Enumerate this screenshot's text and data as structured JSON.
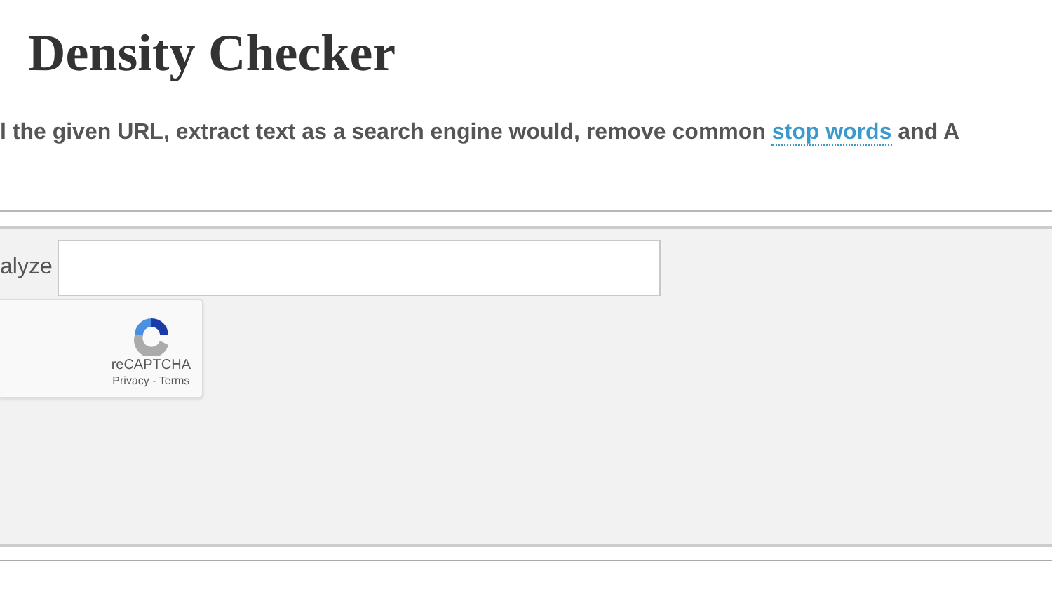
{
  "heading": "Density Checker",
  "description": {
    "before": "l the given URL, extract text as a search engine would, remove common ",
    "link": "stop words",
    "after": " and A"
  },
  "form": {
    "label": "alyze",
    "captcha": {
      "name": "reCAPTCHA",
      "links": "Privacy - Terms"
    }
  }
}
